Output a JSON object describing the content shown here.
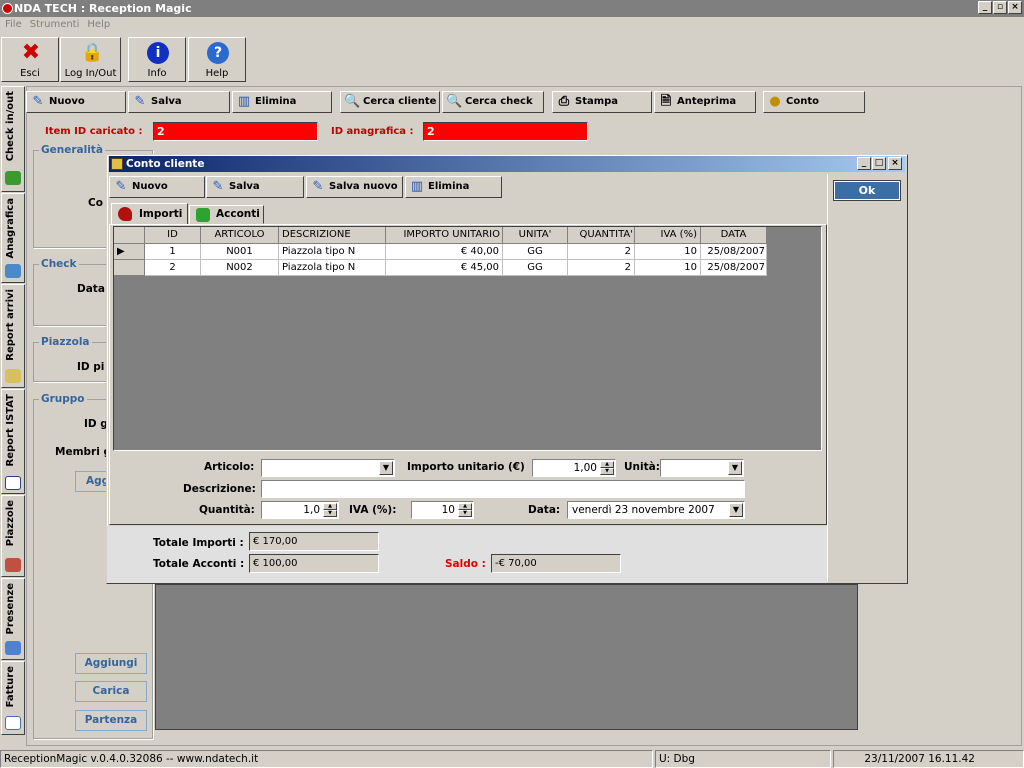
{
  "app": {
    "title": "NDA TECH : Reception Magic"
  },
  "menu": [
    "File",
    "Strumenti",
    "Help"
  ],
  "bigtoolbar": [
    {
      "label": "Esci",
      "icon": "exit-x-icon"
    },
    {
      "label": "Log In/Out",
      "icon": "lock-icon"
    },
    {
      "label": "Info",
      "icon": "info-icon"
    },
    {
      "label": "Help",
      "icon": "help-icon"
    }
  ],
  "sidetabs": [
    "Check in/out",
    "Anagrafica",
    "Report arrivi",
    "Report ISTAT",
    "Piazzole",
    "Presenze",
    "Fatture"
  ],
  "toolbar": [
    "Nuovo",
    "Salva",
    "Elimina",
    "Cerca cliente",
    "Cerca check",
    "Stampa",
    "Anteprima",
    "Conto"
  ],
  "form": {
    "item_label": "Item ID caricato :",
    "item_value": "2",
    "anag_label": "ID anagrafica :",
    "anag_value": "2",
    "groups": [
      "Generalità",
      "Check",
      "Piazzola",
      "Gruppo"
    ],
    "partial_labels": [
      "Co",
      "Data",
      "ID pi",
      "ID g",
      "Membri g",
      "Agg"
    ],
    "buttons": [
      "Aggiungi",
      "Carica",
      "Partenza"
    ]
  },
  "dialog": {
    "title": "Conto cliente",
    "toolbar": [
      "Nuovo",
      "Salva",
      "Salva nuovo",
      "Elimina"
    ],
    "ok": "Ok",
    "tabs": [
      "Importi",
      "Acconti"
    ],
    "columns": [
      "ID",
      "ARTICOLO",
      "DESCRIZIONE",
      "IMPORTO UNITARIO",
      "UNITA'",
      "QUANTITA'",
      "IVA (%)",
      "DATA"
    ],
    "rows": [
      [
        "1",
        "N001",
        "Piazzola tipo N",
        "€ 40,00",
        "GG",
        "2",
        "10",
        "25/08/2007"
      ],
      [
        "2",
        "N002",
        "Piazzola tipo N",
        "€ 45,00",
        "GG",
        "2",
        "10",
        "25/08/2007"
      ]
    ],
    "articolo_label": "Articolo:",
    "articolo_value": "",
    "importo_label": "Importo unitario (€)",
    "importo_value": "1,00",
    "unita_label": "Unità:",
    "unita_value": "",
    "descrizione_label": "Descrizione:",
    "descrizione_value": "",
    "quantita_label": "Quantità:",
    "quantita_value": "1,0",
    "iva_label": "IVA (%):",
    "iva_value": "10",
    "data_label": "Data:",
    "data_value": "venerdì   23 novembre 2007",
    "totale_importi_label": "Totale Importi :",
    "totale_importi": "€ 170,00",
    "totale_acconti_label": "Totale Acconti :",
    "totale_acconti": "€ 100,00",
    "saldo_label": "Saldo :",
    "saldo": "-€ 70,00"
  },
  "status": {
    "version": "ReceptionMagic v.0.4.0.32086 -- www.ndatech.it",
    "user": "U: Dbg",
    "datetime": "23/11/2007 16.11.42"
  }
}
